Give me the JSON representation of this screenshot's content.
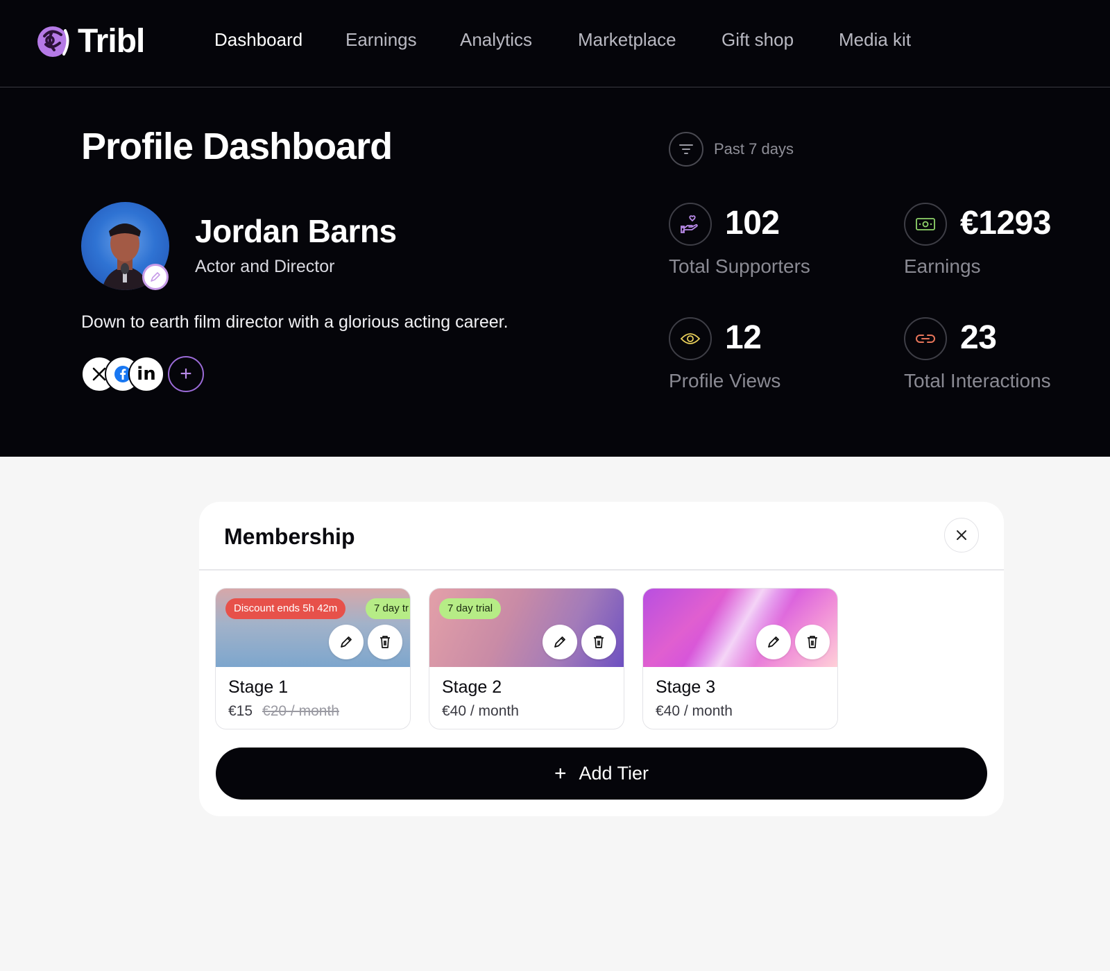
{
  "app": {
    "name": "Tribl"
  },
  "nav": {
    "items": [
      {
        "label": "Dashboard",
        "active": true
      },
      {
        "label": "Earnings",
        "active": false
      },
      {
        "label": "Analytics",
        "active": false
      },
      {
        "label": "Marketplace",
        "active": false
      },
      {
        "label": "Gift shop",
        "active": false
      },
      {
        "label": "Media kit",
        "active": false
      }
    ]
  },
  "page": {
    "title": "Profile Dashboard"
  },
  "profile": {
    "name": "Jordan Barns",
    "role": "Actor and Director",
    "bio": "Down to earth film director with a glorious acting career.",
    "socials": [
      "x-icon",
      "facebook-icon",
      "linkedin-icon"
    ]
  },
  "filter": {
    "label": "Past 7 days"
  },
  "stats": [
    {
      "value": "102",
      "label": "Total Supporters",
      "icon": "hand-heart-icon"
    },
    {
      "value": "€1293",
      "label": "Earnings",
      "icon": "banknote-icon"
    },
    {
      "value": "12",
      "label": "Profile Views",
      "icon": "eye-icon"
    },
    {
      "value": "23",
      "label": "Total Interactions",
      "icon": "link-icon"
    }
  ],
  "membership": {
    "title": "Membership",
    "tiers": [
      {
        "name": "Stage 1",
        "price": "€15",
        "old_price": "€20 / month",
        "discount_badge": "Discount ends 5h 42m",
        "trial_badge": "7 day tr"
      },
      {
        "name": "Stage 2",
        "price": "€40 / month",
        "trial_badge": "7 day trial"
      },
      {
        "name": "Stage 3",
        "price": "€40 / month"
      }
    ],
    "add_label": "Add Tier"
  },
  "colors": {
    "hero_bg": "#05050a",
    "accent_purple": "#9b6bd8",
    "discount_red": "#e7514a",
    "trial_green": "#b6ec86",
    "page_bg": "#f6f6f6"
  }
}
